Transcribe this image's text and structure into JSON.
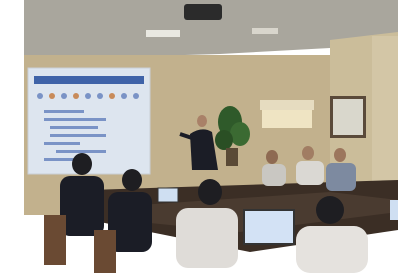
{
  "scene": {
    "kind": "photo",
    "palette": {
      "ceiling": "#aba79c",
      "wall": "#c4b48f",
      "screen": "#dfe7f1",
      "slide_header": "#3f63a8",
      "table": "#3b2e25",
      "suit": "#1b1d26",
      "shirt": "#dfdcd8",
      "plant": "#2f5a2a"
    }
  }
}
